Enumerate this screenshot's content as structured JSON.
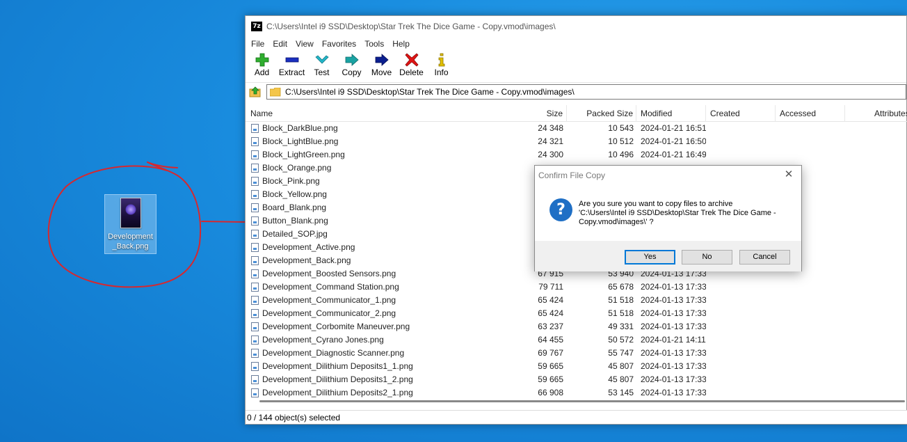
{
  "desktop": {
    "icon_label": "Development\n_Back.png"
  },
  "window": {
    "title": "C:\\Users\\Intel i9 SSD\\Desktop\\Star Trek The Dice Game - Copy.vmod\\images\\",
    "app_icon_text": "7z",
    "menu": [
      "File",
      "Edit",
      "View",
      "Favorites",
      "Tools",
      "Help"
    ],
    "toolbar": [
      {
        "label": "Add",
        "icon": "plus-icon",
        "color": "#2fae2f"
      },
      {
        "label": "Extract",
        "icon": "minus-icon",
        "color": "#1a2fbf"
      },
      {
        "label": "Test",
        "icon": "check-icon",
        "color": "#22b7c9"
      },
      {
        "label": "Copy",
        "icon": "copy-arrow-icon",
        "color": "#1aa3a3"
      },
      {
        "label": "Move",
        "icon": "move-arrow-icon",
        "color": "#0b1f8f"
      },
      {
        "label": "Delete",
        "icon": "delete-x-icon",
        "color": "#e01414"
      },
      {
        "label": "Info",
        "icon": "info-icon",
        "color": "#e2c000"
      }
    ],
    "address": "C:\\Users\\Intel i9 SSD\\Desktop\\Star Trek The Dice Game - Copy.vmod\\images\\",
    "columns": [
      "Name",
      "Size",
      "Packed Size",
      "Modified",
      "Created",
      "Accessed",
      "Attributes"
    ],
    "rows": [
      {
        "name": "Block_DarkBlue.png",
        "size": "24 348",
        "packed": "10 543",
        "modified": "2024-01-21 16:51"
      },
      {
        "name": "Block_LightBlue.png",
        "size": "24 321",
        "packed": "10 512",
        "modified": "2024-01-21 16:50"
      },
      {
        "name": "Block_LightGreen.png",
        "size": "24 300",
        "packed": "10 496",
        "modified": "2024-01-21 16:49"
      },
      {
        "name": "Block_Orange.png",
        "size": "",
        "packed": "",
        "modified": ""
      },
      {
        "name": "Block_Pink.png",
        "size": "",
        "packed": "",
        "modified": ""
      },
      {
        "name": "Block_Yellow.png",
        "size": "",
        "packed": "",
        "modified": ""
      },
      {
        "name": "Board_Blank.png",
        "size": "",
        "packed": "",
        "modified": ""
      },
      {
        "name": "Button_Blank.png",
        "size": "",
        "packed": "",
        "modified": ""
      },
      {
        "name": "Detailed_SOP.jpg",
        "size": "",
        "packed": "",
        "modified": ""
      },
      {
        "name": "Development_Active.png",
        "size": "",
        "packed": "",
        "modified": ""
      },
      {
        "name": "Development_Back.png",
        "size": "",
        "packed": "",
        "modified": ""
      },
      {
        "name": "Development_Boosted Sensors.png",
        "size": "67 915",
        "packed": "53 940",
        "modified": "2024-01-13 17:33"
      },
      {
        "name": "Development_Command Station.png",
        "size": "79 711",
        "packed": "65 678",
        "modified": "2024-01-13 17:33"
      },
      {
        "name": "Development_Communicator_1.png",
        "size": "65 424",
        "packed": "51 518",
        "modified": "2024-01-13 17:33"
      },
      {
        "name": "Development_Communicator_2.png",
        "size": "65 424",
        "packed": "51 518",
        "modified": "2024-01-13 17:33"
      },
      {
        "name": "Development_Corbomite Maneuver.png",
        "size": "63 237",
        "packed": "49 331",
        "modified": "2024-01-13 17:33"
      },
      {
        "name": "Development_Cyrano Jones.png",
        "size": "64 455",
        "packed": "50 572",
        "modified": "2024-01-21 14:11"
      },
      {
        "name": "Development_Diagnostic Scanner.png",
        "size": "69 767",
        "packed": "55 747",
        "modified": "2024-01-13 17:33"
      },
      {
        "name": "Development_Dilithium Deposits1_1.png",
        "size": "59 665",
        "packed": "45 807",
        "modified": "2024-01-13 17:33"
      },
      {
        "name": "Development_Dilithium Deposits1_2.png",
        "size": "59 665",
        "packed": "45 807",
        "modified": "2024-01-13 17:33"
      },
      {
        "name": "Development_Dilithium Deposits2_1.png",
        "size": "66 908",
        "packed": "53 145",
        "modified": "2024-01-13 17:33"
      }
    ],
    "status": "0 / 144 object(s) selected"
  },
  "dialog": {
    "title": "Confirm File Copy",
    "message": "Are you sure you want to copy files to archive\n'C:\\Users\\Intel i9 SSD\\Desktop\\Star Trek The Dice Game - Copy.vmod\\images\\' ?",
    "buttons": {
      "yes": "Yes",
      "no": "No",
      "cancel": "Cancel"
    }
  },
  "colors": {
    "desktop_blue": "#1a8ee0",
    "annotation_red": "#d6282f",
    "question_icon_blue": "#1f6fc5",
    "default_button_border": "#0078d7"
  }
}
